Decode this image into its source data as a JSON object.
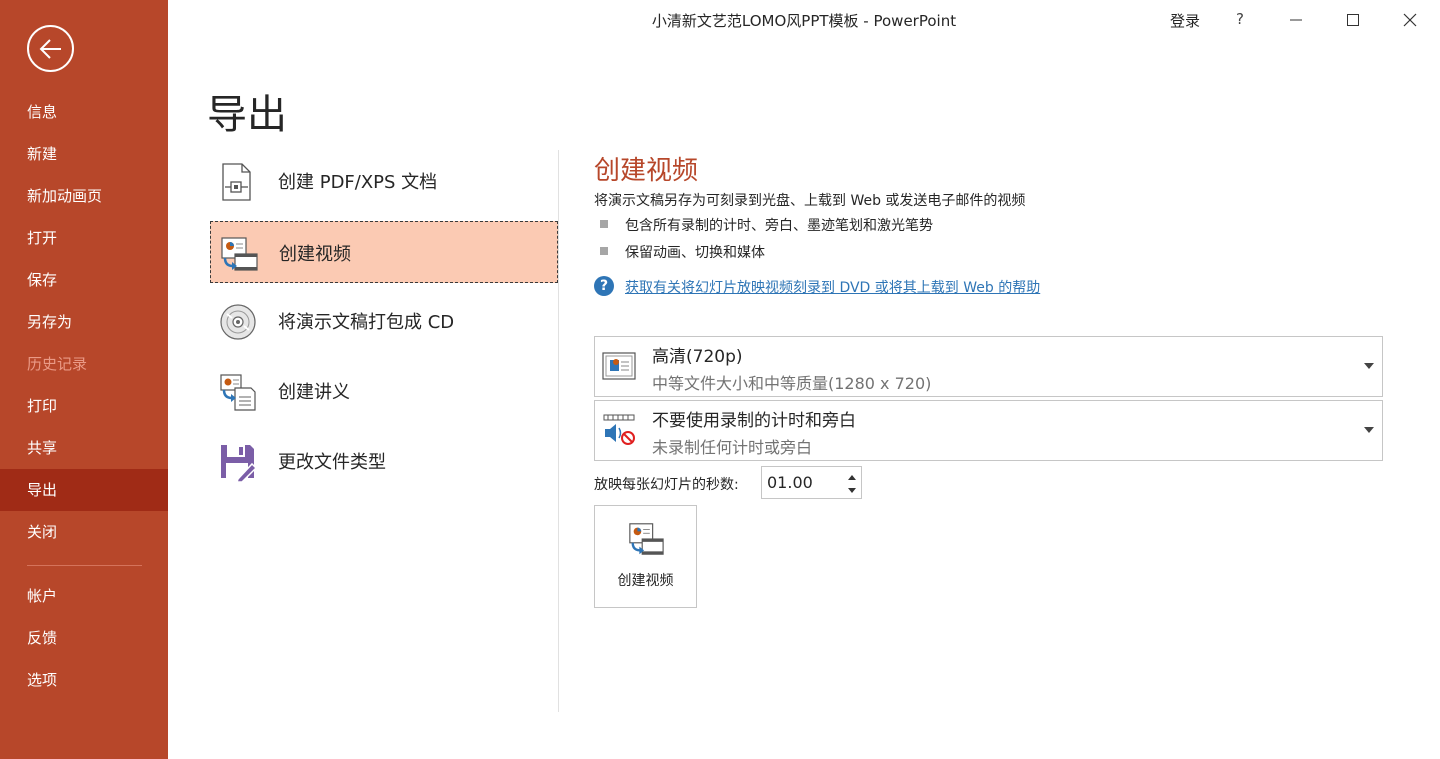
{
  "window": {
    "title": "小清新文艺范LOMO风PPT模板  -  PowerPoint",
    "login_label": "登录",
    "help_label": "?"
  },
  "sidebar": {
    "items": [
      {
        "label": "信息"
      },
      {
        "label": "新建"
      },
      {
        "label": "新加动画页"
      },
      {
        "label": "打开"
      },
      {
        "label": "保存"
      },
      {
        "label": "另存为"
      },
      {
        "label": "历史记录"
      },
      {
        "label": "打印"
      },
      {
        "label": "共享"
      },
      {
        "label": "导出"
      },
      {
        "label": "关闭"
      },
      {
        "label": "帐户"
      },
      {
        "label": "反馈"
      },
      {
        "label": "选项"
      }
    ],
    "active_item": "导出",
    "disabled_item": "历史记录"
  },
  "page": {
    "title": "导出"
  },
  "export_options": [
    {
      "label": "创建 PDF/XPS 文档",
      "icon": "pdf-document-icon"
    },
    {
      "label": "创建视频",
      "icon": "video-icon"
    },
    {
      "label": "将演示文稿打包成 CD",
      "icon": "cd-icon"
    },
    {
      "label": "创建讲义",
      "icon": "handout-icon"
    },
    {
      "label": "更改文件类型",
      "icon": "save-as-type-icon"
    }
  ],
  "detail": {
    "title": "创建视频",
    "description": "将演示文稿另存为可刻录到光盘、上载到 Web 或发送电子邮件的视频",
    "bullets": [
      "包含所有录制的计时、旁白、墨迹笔划和激光笔势",
      "保留动画、切换和媒体"
    ],
    "help_link": "获取有关将幻灯片放映视频刻录到 DVD 或将其上载到 Web 的帮助",
    "quality": {
      "main": "高清(720p)",
      "sub": "中等文件大小和中等质量(1280 x 720)"
    },
    "timing": {
      "main": "不要使用录制的计时和旁白",
      "sub": "未录制任何计时或旁白"
    },
    "seconds_label": "放映每张幻灯片的秒数:",
    "seconds_value": "01.00",
    "create_button_label": "创建视频"
  },
  "colors": {
    "sidebar_bg": "#b7472a",
    "sidebar_active": "#a02b16",
    "selected_option_bg": "#fbcab3",
    "accent_title": "#b7472a",
    "link": "#2e75b6"
  }
}
